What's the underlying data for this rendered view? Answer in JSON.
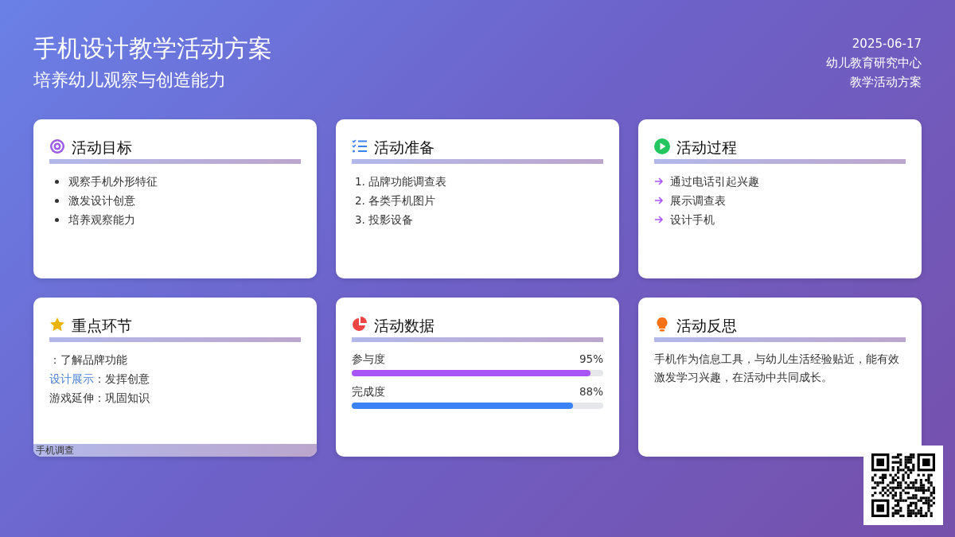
{
  "header": {
    "title": "手机设计教学活动方案",
    "subtitle": "培养幼儿观察与创造能力",
    "date": "2025-06-17",
    "org": "幼儿教育研究中心",
    "doc_type": "教学活动方案"
  },
  "cards": [
    {
      "kind": "bullets",
      "title": "活动目标",
      "items": [
        "观察手机外形特征",
        "激发设计创意",
        "培养观察能力"
      ]
    },
    {
      "kind": "numbered",
      "title": "活动准备",
      "items": [
        {
          "number": "1.",
          "text": "品牌功能调查表"
        },
        {
          "number": "2.",
          "text": "各类手机图片"
        },
        {
          "number": "3.",
          "text": "投影设备"
        }
      ]
    },
    {
      "kind": "arrows",
      "title": "活动过程",
      "items": [
        "通过电话引起兴趣",
        "展示调查表",
        "设计手机"
      ]
    },
    {
      "kind": "labeled",
      "title": "重点环节",
      "items": [
        {
          "text": "：了解品牌功能"
        },
        {
          "label": "设计展示",
          "highlighted": true,
          "text": "：发挥创意"
        },
        {
          "label": "游戏延伸",
          "highlighted": false,
          "text": "：巩固知识"
        }
      ],
      "overflow_text": "手机调查"
    },
    {
      "kind": "meters",
      "title": "活动数据",
      "items": [
        {
          "label": "参与度",
          "reading": "95%",
          "level": 0.95,
          "color": "#a855f7"
        },
        {
          "label": "完成度",
          "reading": "88%",
          "level": 0.88,
          "color": "#3b82f6"
        }
      ]
    },
    {
      "kind": "paragraph",
      "title": "活动反思",
      "text": "手机作为信息工具，与幼儿生活经验贴近，能有效激发学习兴趣，在活动中共同成长。"
    }
  ]
}
